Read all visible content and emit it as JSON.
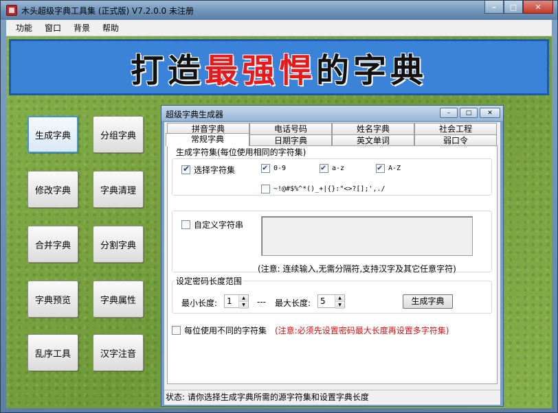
{
  "window": {
    "title": "木头超级字典工具集 (正式版) V7.2.0.0    未注册",
    "min_glyph": "–",
    "max_glyph": "□",
    "close_glyph": "✕"
  },
  "menu": [
    "功能",
    "窗口",
    "背景",
    "帮助"
  ],
  "banner": {
    "part1": "打造",
    "part2": "最强悍",
    "part3": "的字典"
  },
  "tools": [
    "生成字典",
    "分组字典",
    "修改字典",
    "字典清理",
    "合并字典",
    "分割字典",
    "字典预览",
    "字典属性",
    "乱序工具",
    "汉字注音"
  ],
  "dialog": {
    "title": "超级字典生成器",
    "tabs_top": [
      "拼音字典",
      "电话号码",
      "姓名字典",
      "社会工程"
    ],
    "tabs_bottom": [
      "常规字典",
      "日期字典",
      "英文单词",
      "弱口令"
    ],
    "charset_group": "生成字符集(每位使用相同的字符集)",
    "select_charset": "选择字符集",
    "cb_digits": "0-9",
    "cb_lower": "a-z",
    "cb_upper": "A-Z",
    "cb_special": "~!@#$%^*()_+|{}:\"<>?[];',./",
    "custom_label": "自定义字符串",
    "custom_value": "",
    "custom_note": "(注意: 连续输入,无需分隔符,支持汉字及其它任意字符)",
    "length_group": "设定密码长度范围",
    "min_label": "最小长度:",
    "min_value": "1",
    "sep": "---",
    "max_label": "最大长度:",
    "max_value": "5",
    "generate_btn": "生成字典",
    "diff_charset": "每位使用不同的字符集",
    "diff_note": "(注意:必须先设置密码最大长度再设置多字符集)",
    "status": "状态:  请你选择生成字典所需的源字符集和设置字典长度",
    "checks": {
      "select_charset": true,
      "digits": true,
      "lower": true,
      "upper": true,
      "special": false,
      "custom": false,
      "diff": false
    }
  }
}
